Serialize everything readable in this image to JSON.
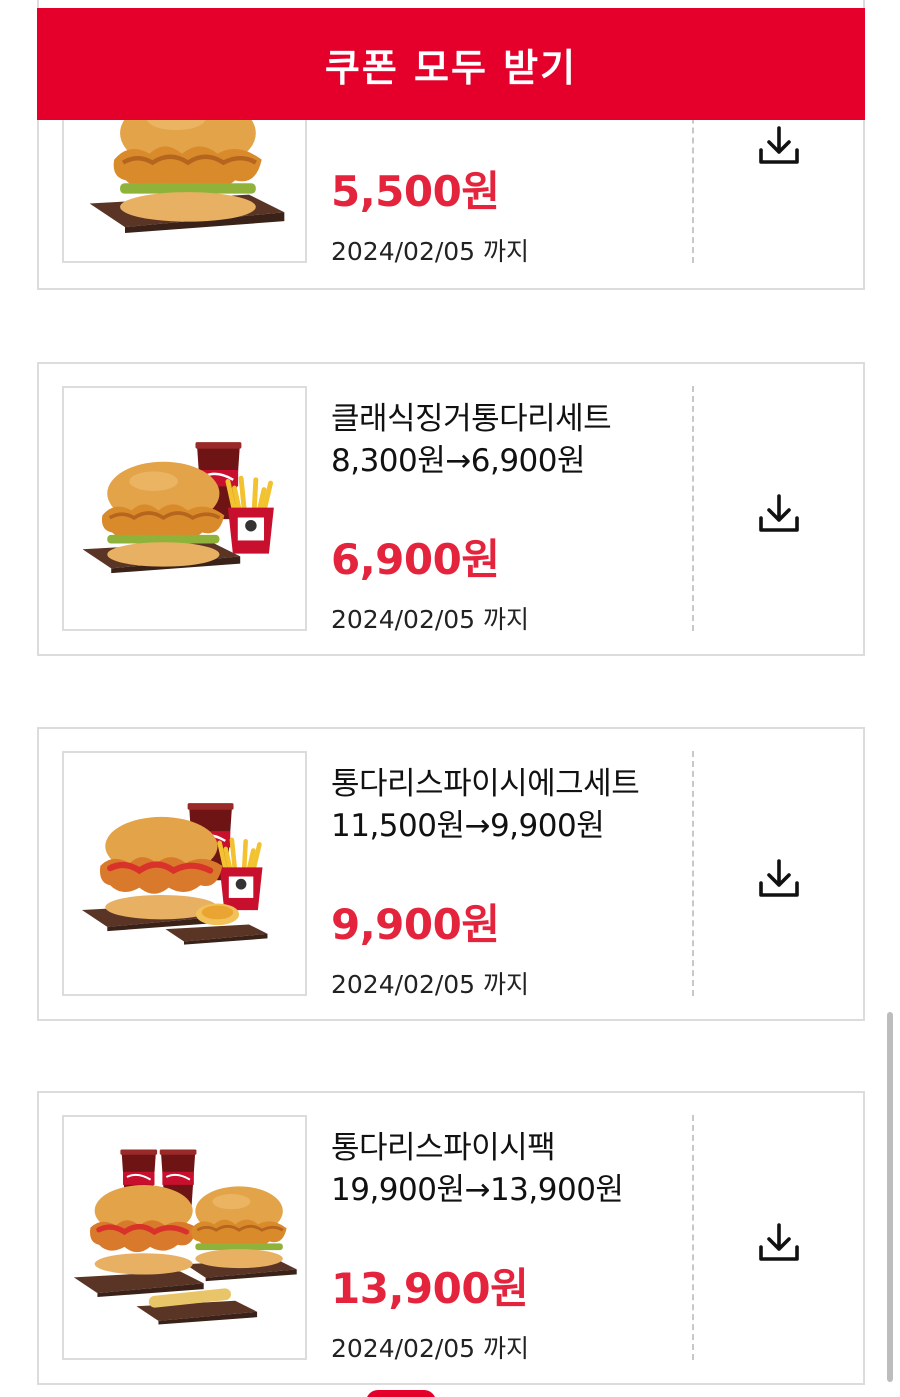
{
  "header": {
    "claim_all_label": "쿠폰 모두 받기"
  },
  "coupons": [
    {
      "name": "",
      "original_price": "",
      "price": "5,500원",
      "valid_until": "2024/02/05 까지",
      "image": "chicken-burger-photo"
    },
    {
      "name": "클래식징거통다리세트",
      "original_price": "8,300원→6,900원",
      "price": "6,900원",
      "valid_until": "2024/02/05 까지",
      "image": "burger-set-with-cola-and-fries-photo"
    },
    {
      "name": "통다리스파이시에그세트",
      "original_price": "11,500원→9,900원",
      "price": "9,900원",
      "valid_until": "2024/02/05 까지",
      "image": "spicy-burger-set-with-egg-tart-photo"
    },
    {
      "name": "통다리스파이시팩",
      "original_price": "19,900원→13,900원",
      "price": "13,900원",
      "valid_until": "2024/02/05 까지",
      "image": "two-burger-pack-with-colas-photo"
    }
  ],
  "icons": {
    "download": "download-icon"
  },
  "colors": {
    "accent": "#e4002b",
    "price": "#e4243d",
    "border": "#dcdcdc"
  }
}
